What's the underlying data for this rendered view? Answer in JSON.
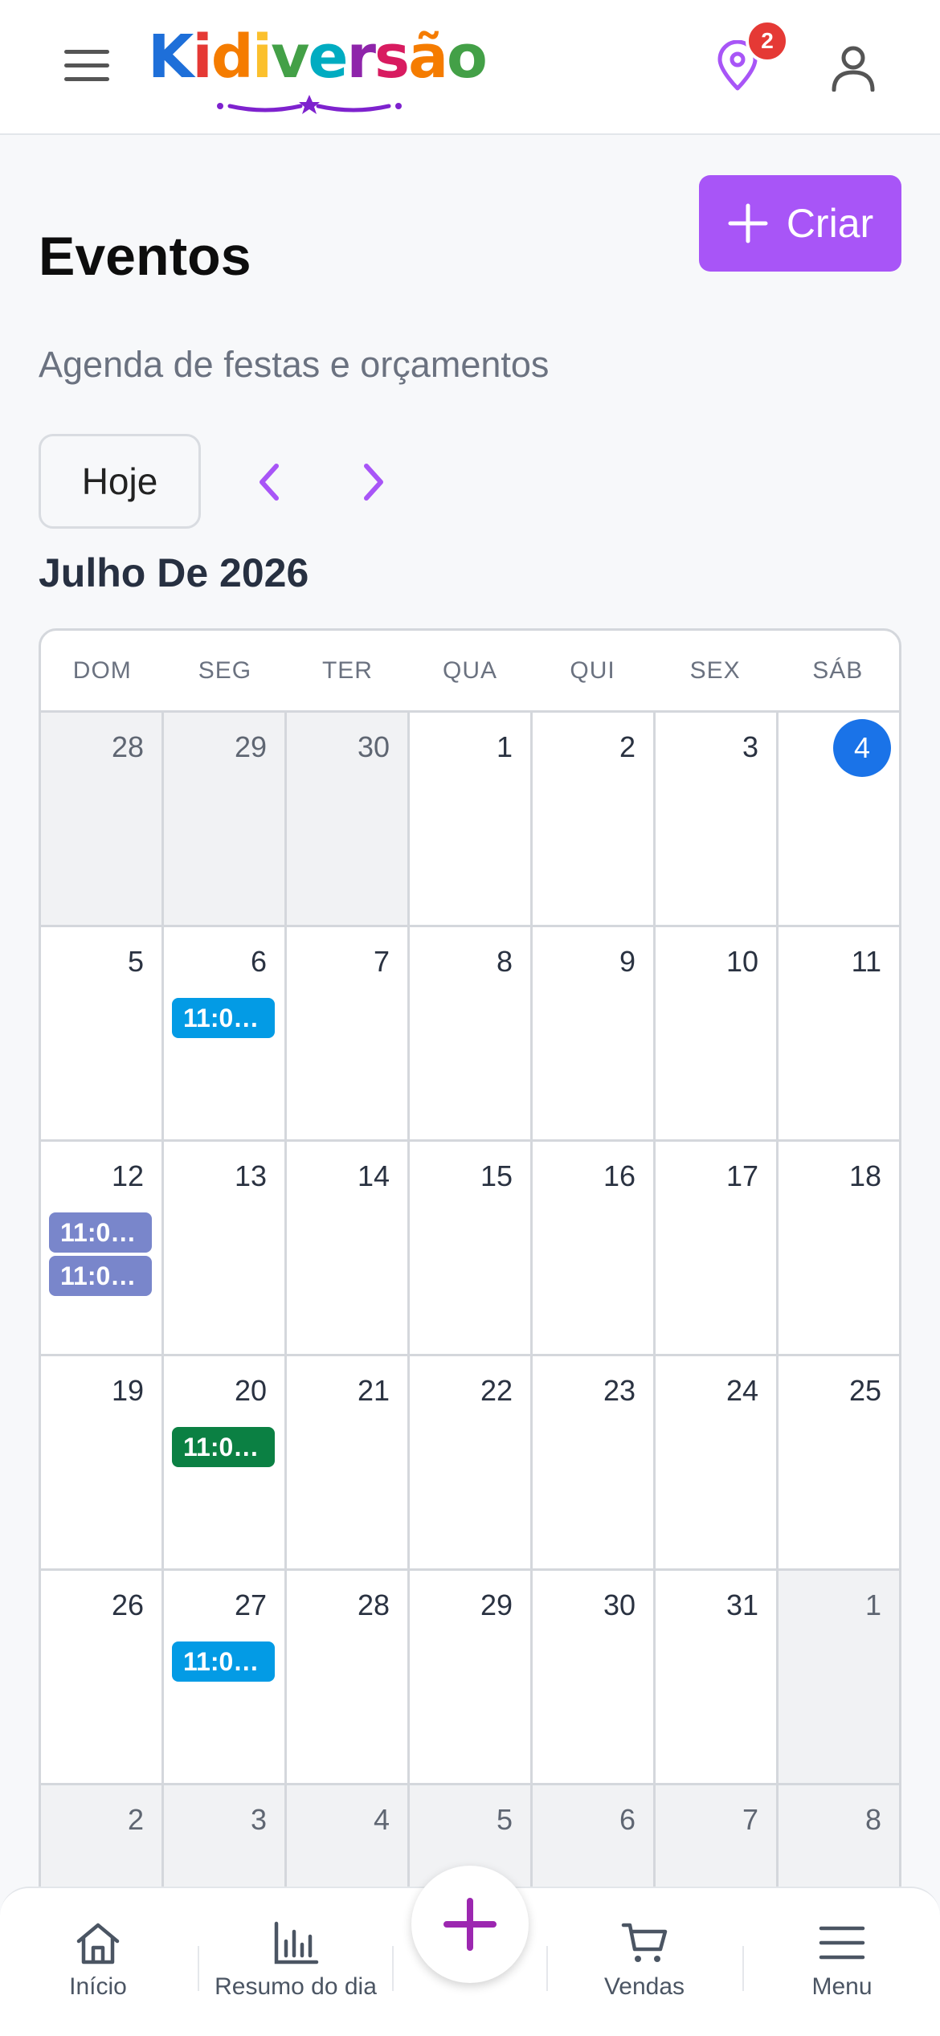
{
  "header": {
    "logo_text": "Kidiversão",
    "notification_count": "2"
  },
  "page": {
    "title": "Eventos",
    "subtitle": "Agenda de festas e orçamentos",
    "create_label": "Criar",
    "today_label": "Hoje",
    "month_title": "Julho De 2026"
  },
  "calendar": {
    "weekdays": [
      "DOM",
      "SEG",
      "TER",
      "QUA",
      "QUI",
      "SEX",
      "SÁB"
    ],
    "weeks": [
      [
        {
          "day": "28",
          "other": true
        },
        {
          "day": "29",
          "other": true
        },
        {
          "day": "30",
          "other": true
        },
        {
          "day": "1"
        },
        {
          "day": "2"
        },
        {
          "day": "3"
        },
        {
          "day": "4",
          "today": true
        }
      ],
      [
        {
          "day": "5"
        },
        {
          "day": "6",
          "events": [
            {
              "label": "11:0…",
              "color": "#039be5"
            }
          ]
        },
        {
          "day": "7"
        },
        {
          "day": "8"
        },
        {
          "day": "9"
        },
        {
          "day": "10"
        },
        {
          "day": "11"
        }
      ],
      [
        {
          "day": "12",
          "events": [
            {
              "label": "11:0…",
              "color": "#7986cb"
            },
            {
              "label": "11:0…",
              "color": "#7986cb"
            }
          ]
        },
        {
          "day": "13"
        },
        {
          "day": "14"
        },
        {
          "day": "15"
        },
        {
          "day": "16"
        },
        {
          "day": "17"
        },
        {
          "day": "18"
        }
      ],
      [
        {
          "day": "19"
        },
        {
          "day": "20",
          "events": [
            {
              "label": "11:0…",
              "color": "#0b8043"
            }
          ]
        },
        {
          "day": "21"
        },
        {
          "day": "22"
        },
        {
          "day": "23"
        },
        {
          "day": "24"
        },
        {
          "day": "25"
        }
      ],
      [
        {
          "day": "26"
        },
        {
          "day": "27",
          "events": [
            {
              "label": "11:0…",
              "color": "#039be5"
            }
          ]
        },
        {
          "day": "28"
        },
        {
          "day": "29"
        },
        {
          "day": "30"
        },
        {
          "day": "31"
        },
        {
          "day": "1",
          "other": true
        }
      ],
      [
        {
          "day": "2",
          "other": true
        },
        {
          "day": "3",
          "other": true
        },
        {
          "day": "4",
          "other": true
        },
        {
          "day": "5",
          "other": true
        },
        {
          "day": "6",
          "other": true
        },
        {
          "day": "7",
          "other": true
        },
        {
          "day": "8",
          "other": true
        }
      ]
    ]
  },
  "bottom_nav": {
    "home": "Início",
    "summary": "Resumo do dia",
    "sales": "Vendas",
    "menu": "Menu"
  },
  "colors": {
    "accent": "#a855f7",
    "today": "#1a73e8"
  }
}
